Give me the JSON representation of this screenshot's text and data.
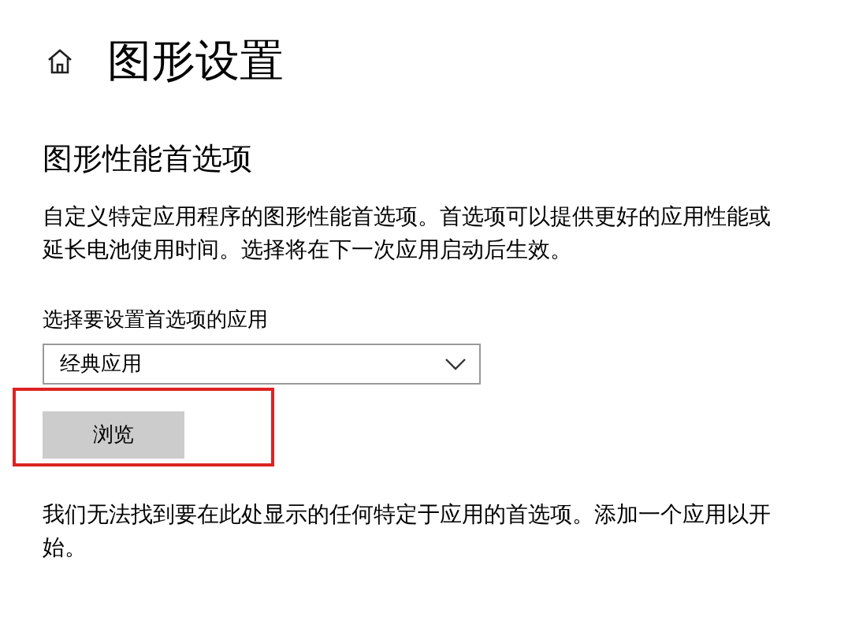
{
  "window": {
    "title": "图形设置"
  },
  "section": {
    "heading": "图形性能首选项",
    "description": "自定义特定应用程序的图形性能首选项。首选项可以提供更好的应用性能或延长电池使用时间。选择将在下一次应用启动后生效。"
  },
  "app_picker": {
    "label": "选择要设置首选项的应用",
    "value": "经典应用"
  },
  "buttons": [
    {
      "label": "浏览"
    }
  ],
  "empty_message": "我们无法找到要在此处显示的任何特定于应用的首选项。添加一个应用以开始。"
}
